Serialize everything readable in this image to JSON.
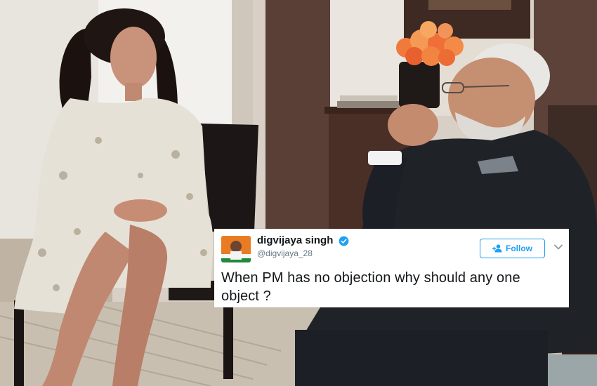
{
  "tweet": {
    "display_name": "digvijaya singh",
    "handle": "@digvijaya_28",
    "follow_label": "Follow",
    "text": "When PM has no objection why should any one object ?",
    "verified": true
  },
  "colors": {
    "accent": "#1da1f2",
    "name_text": "#14171a",
    "handle_text": "#657786",
    "avatar_bg": "#e97c22"
  },
  "icons": {
    "verified": "verified-badge-icon",
    "follow": "add-person-icon",
    "more": "chevron-down-icon"
  }
}
